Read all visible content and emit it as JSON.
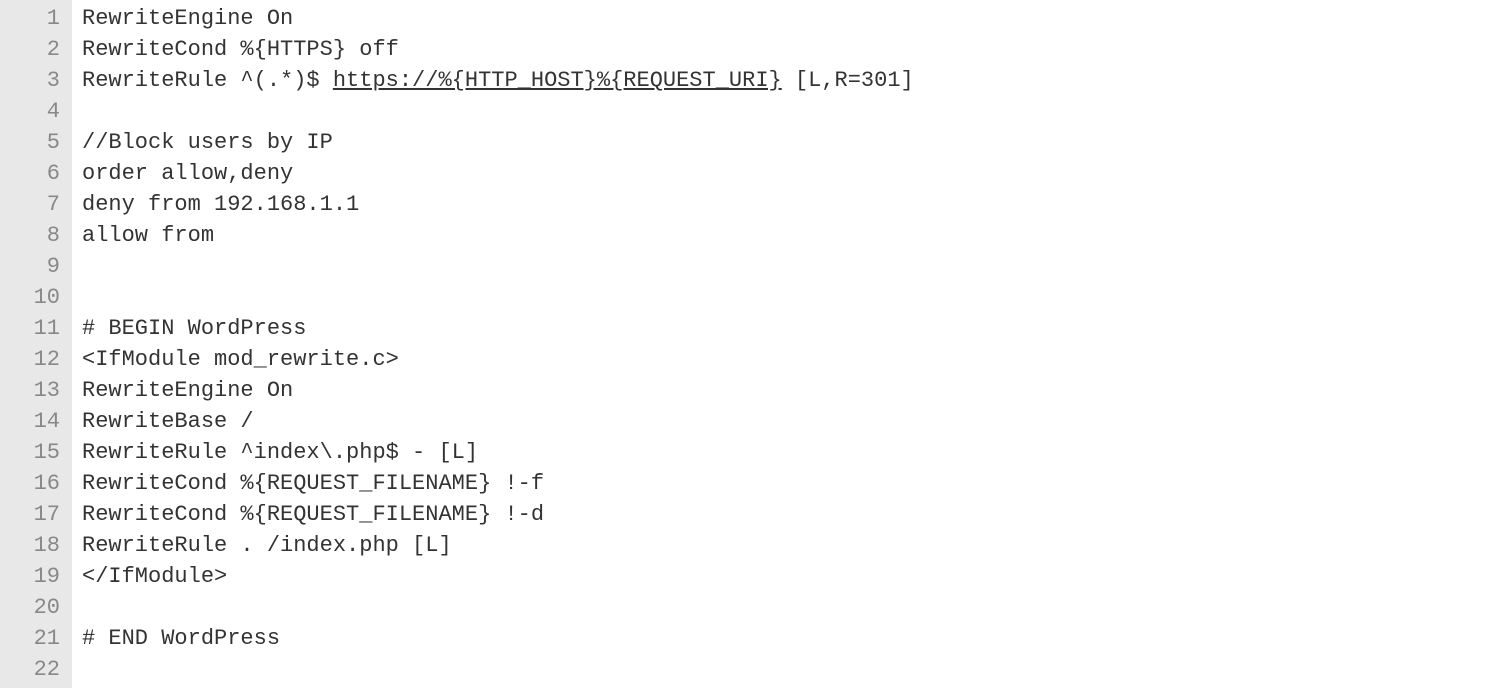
{
  "colors": {
    "gutter_bg": "#e8e8e8",
    "gutter_fg": "#888888",
    "code_fg": "#333333"
  },
  "lines": [
    {
      "n": 1,
      "segments": [
        {
          "text": "RewriteEngine On"
        }
      ]
    },
    {
      "n": 2,
      "segments": [
        {
          "text": "RewriteCond %{HTTPS} off"
        }
      ]
    },
    {
      "n": 3,
      "segments": [
        {
          "text": "RewriteRule ^(.*)$ "
        },
        {
          "text": "https://%{HTTP_HOST}%{REQUEST_URI}",
          "underline": true
        },
        {
          "text": " [L,R=301]"
        }
      ]
    },
    {
      "n": 4,
      "segments": [
        {
          "text": ""
        }
      ]
    },
    {
      "n": 5,
      "segments": [
        {
          "text": "//Block users by IP"
        }
      ]
    },
    {
      "n": 6,
      "segments": [
        {
          "text": "order allow,deny"
        }
      ]
    },
    {
      "n": 7,
      "segments": [
        {
          "text": "deny from 192.168.1.1"
        }
      ]
    },
    {
      "n": 8,
      "segments": [
        {
          "text": "allow from"
        }
      ]
    },
    {
      "n": 9,
      "segments": [
        {
          "text": ""
        }
      ]
    },
    {
      "n": 10,
      "segments": [
        {
          "text": ""
        }
      ]
    },
    {
      "n": 11,
      "segments": [
        {
          "text": "# BEGIN WordPress"
        }
      ]
    },
    {
      "n": 12,
      "segments": [
        {
          "text": "<IfModule mod_rewrite.c>"
        }
      ]
    },
    {
      "n": 13,
      "segments": [
        {
          "text": "RewriteEngine On"
        }
      ]
    },
    {
      "n": 14,
      "segments": [
        {
          "text": "RewriteBase /"
        }
      ]
    },
    {
      "n": 15,
      "segments": [
        {
          "text": "RewriteRule ^index\\.php$ - [L]"
        }
      ]
    },
    {
      "n": 16,
      "segments": [
        {
          "text": "RewriteCond %{REQUEST_FILENAME} !-f"
        }
      ]
    },
    {
      "n": 17,
      "segments": [
        {
          "text": "RewriteCond %{REQUEST_FILENAME} !-d"
        }
      ]
    },
    {
      "n": 18,
      "segments": [
        {
          "text": "RewriteRule . /index.php [L]"
        }
      ]
    },
    {
      "n": 19,
      "segments": [
        {
          "text": "</IfModule>"
        }
      ]
    },
    {
      "n": 20,
      "segments": [
        {
          "text": ""
        }
      ]
    },
    {
      "n": 21,
      "segments": [
        {
          "text": "# END WordPress"
        }
      ]
    },
    {
      "n": 22,
      "segments": [
        {
          "text": ""
        }
      ]
    }
  ]
}
